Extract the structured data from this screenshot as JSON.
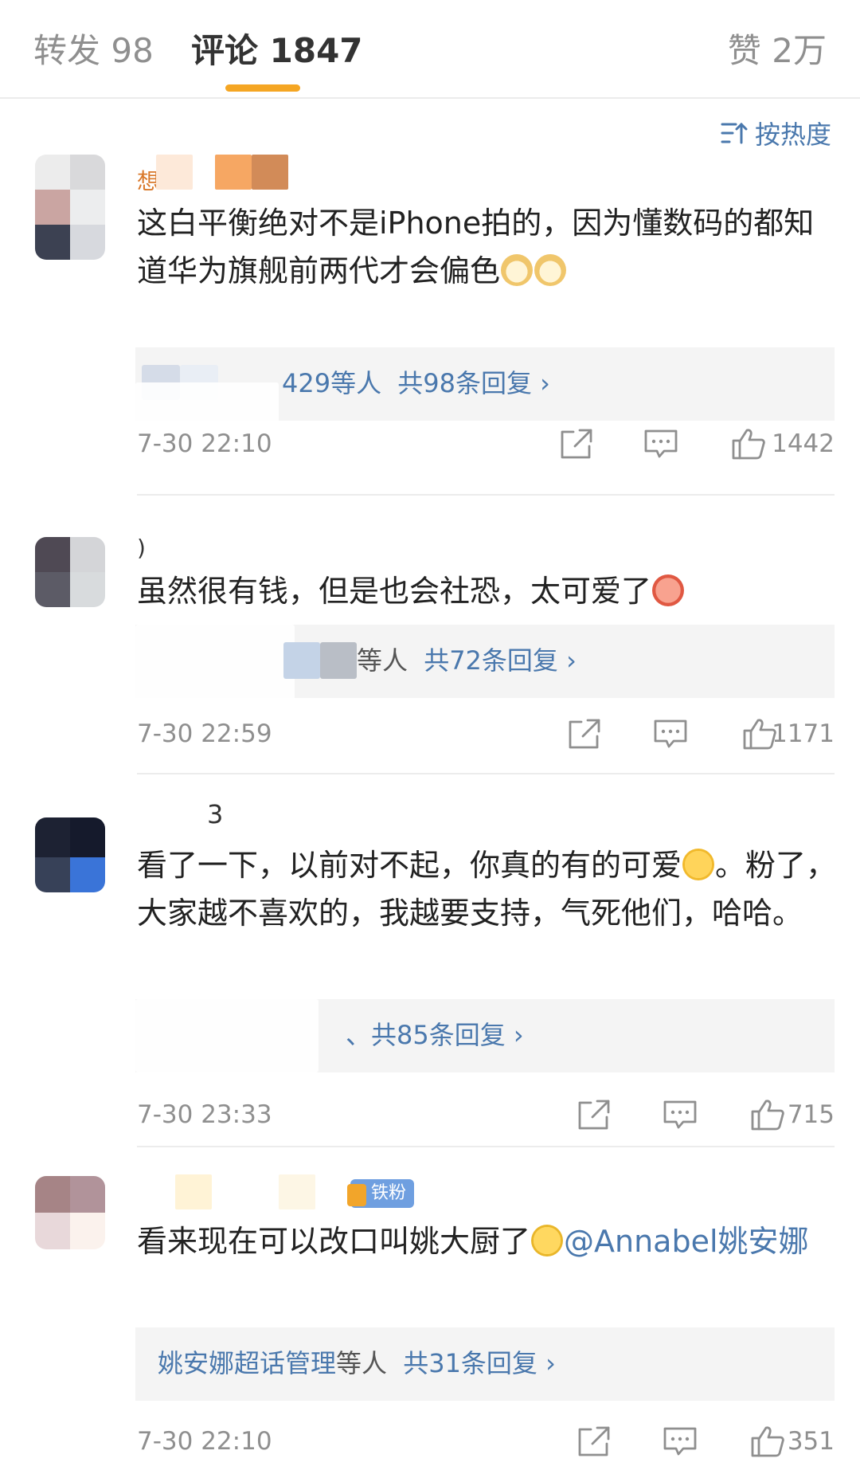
{
  "tabs": {
    "repost": "转发 98",
    "comment": "评论 1847",
    "like": "赞 2万"
  },
  "sort": {
    "label": "按热度",
    "icon": "sort-icon"
  },
  "colors": {
    "accent": "#f5a623",
    "link": "#4a78ad",
    "username": "#d9782a",
    "muted": "#8f8f8f"
  },
  "comments": [
    {
      "username_visible": "想",
      "text": "这白平衡绝对不是iPhone拍的，因为懂数码的都知道华为旗舰前两代才会偏色",
      "emojis": [
        "doge-emoji",
        "doge-emoji"
      ],
      "reply_users": "429等人",
      "reply_total": "共98条回复 ›",
      "time": "7-30 22:10",
      "likes": "1442"
    },
    {
      "username_visible": ")",
      "text": "虽然很有钱，但是也会社恐，太可爱了",
      "emojis": [
        "cute-emoji"
      ],
      "reply_users": "等人",
      "reply_total": "共72条回复 ›",
      "time": "7-30 22:59",
      "likes": "1171"
    },
    {
      "username_visible": "3",
      "text_part1": "看了一下，以前对不起，你真的有的可爱",
      "emojis": [
        "smile-emoji"
      ],
      "text_part2": "。粉了，大家越不喜欢的，我越要支持，气死他们，哈哈。",
      "reply_users": "、",
      "reply_total": "共85条回复 ›",
      "time": "7-30 23:33",
      "likes": "715"
    },
    {
      "badge": "铁粉",
      "text": "看来现在可以改口叫姚大厨了",
      "emojis": [
        "thinking-emoji"
      ],
      "mention": "@Annabel姚安娜",
      "reply_users": "姚安娜超话管理",
      "reply_suffix": "等人",
      "reply_total": "共31条回复 ›",
      "time": "7-30 22:10",
      "likes": "351"
    }
  ]
}
